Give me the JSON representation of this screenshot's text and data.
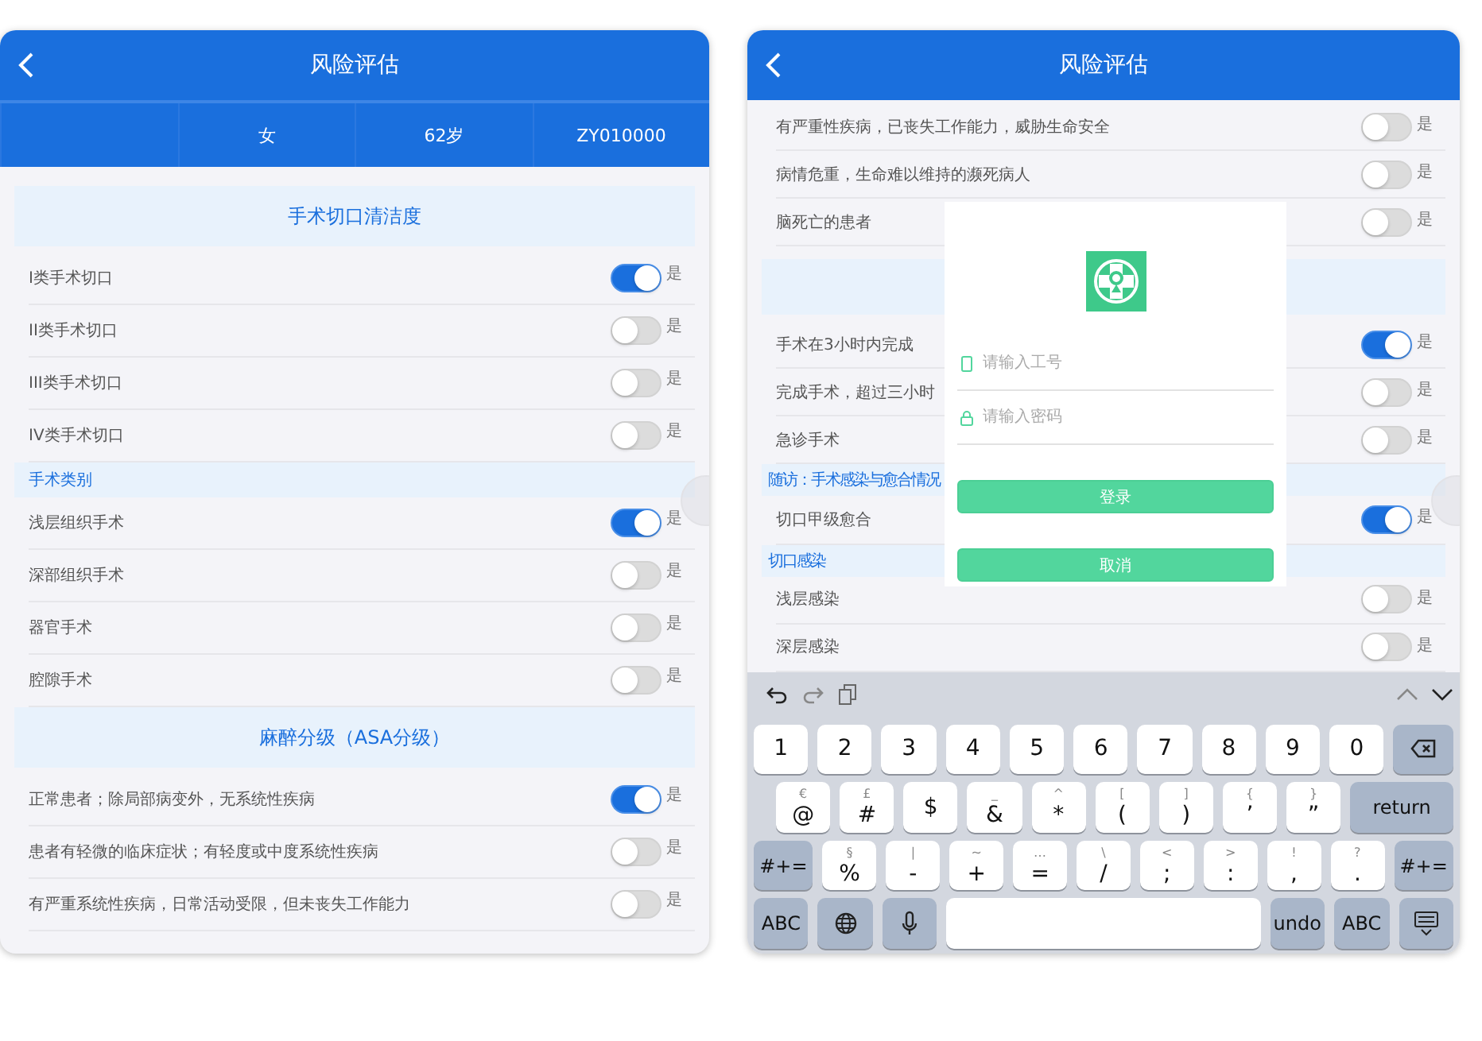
{
  "screens": [
    {
      "header": {
        "title": "风险评估"
      },
      "patient": [
        "女",
        "62岁",
        "ZY010000"
      ],
      "items": [
        {
          "kind": "section",
          "title": "手术切口清洁度"
        },
        {
          "kind": "toggle",
          "label": "I类手术切口",
          "on": true,
          "suffix": "是"
        },
        {
          "kind": "toggle",
          "label": "II类手术切口",
          "on": false,
          "suffix": "是"
        },
        {
          "kind": "toggle",
          "label": "III类手术切口",
          "on": false,
          "suffix": "是"
        },
        {
          "kind": "toggle",
          "label": "IV类手术切口",
          "on": false,
          "suffix": "是"
        },
        {
          "kind": "subsection",
          "title": "手术类别"
        },
        {
          "kind": "toggle",
          "label": "浅层组织手术",
          "on": true,
          "suffix": "是"
        },
        {
          "kind": "toggle",
          "label": "深部组织手术",
          "on": false,
          "suffix": "是"
        },
        {
          "kind": "toggle",
          "label": "器官手术",
          "on": false,
          "suffix": "是"
        },
        {
          "kind": "toggle",
          "label": "腔隙手术",
          "on": false,
          "suffix": "是"
        },
        {
          "kind": "section",
          "title": "麻醉分级（ASA分级）"
        },
        {
          "kind": "toggle",
          "label": "正常患者；除局部病变外，无系统性疾病",
          "on": true,
          "suffix": "是"
        },
        {
          "kind": "toggle",
          "label": "患者有轻微的临床症状；有轻度或中度系统性疾病",
          "on": false,
          "suffix": "是"
        },
        {
          "kind": "toggle",
          "label": "有严重系统性疾病，日常活动受限，但未丧失工作能力",
          "on": false,
          "suffix": "是"
        }
      ]
    },
    {
      "header": {
        "title": "风险评估"
      },
      "items": [
        {
          "kind": "toggle",
          "label": "有严重性疾病，已丧失工作能力，威胁生命安全",
          "on": false,
          "suffix": "是"
        },
        {
          "kind": "toggle",
          "label": "病情危重，生命难以维持的濒死病人",
          "on": false,
          "suffix": "是"
        },
        {
          "kind": "toggle",
          "label": "脑死亡的患者",
          "on": false,
          "suffix": "是"
        },
        {
          "kind": "section"
        },
        {
          "kind": "toggle",
          "label": "手术在3小时内完成",
          "on": true,
          "suffix": "是"
        },
        {
          "kind": "toggle",
          "label": "完成手术，超过三小时",
          "on": false,
          "suffix": "是"
        },
        {
          "kind": "toggle",
          "label": "急诊手术",
          "on": false,
          "suffix": "是"
        },
        {
          "kind": "subsection",
          "title": "随访：手术感染与愈合情况"
        },
        {
          "kind": "toggle",
          "label": "切口甲级愈合",
          "on": true,
          "suffix": "是"
        },
        {
          "kind": "subsection",
          "title": "切口感染"
        },
        {
          "kind": "toggle",
          "label": "浅层感染",
          "on": false,
          "suffix": "是"
        },
        {
          "kind": "toggle",
          "label": "深层感染",
          "on": false,
          "suffix": "是"
        }
      ],
      "dialog": {
        "fields": [
          {
            "kind": "phone",
            "placeholder": "请输入工号"
          },
          {
            "kind": "lock",
            "placeholder": "请输入密码"
          }
        ],
        "buttons": [
          "登录",
          "取消"
        ]
      },
      "keyboard": {
        "number_row": [
          {
            "kind": "key",
            "main": "1"
          },
          {
            "kind": "key",
            "main": "2"
          },
          {
            "kind": "key",
            "main": "3"
          },
          {
            "kind": "key",
            "main": "4"
          },
          {
            "kind": "key",
            "main": "5"
          },
          {
            "kind": "key",
            "main": "6"
          },
          {
            "kind": "key",
            "main": "7"
          },
          {
            "kind": "key",
            "main": "8"
          },
          {
            "kind": "key",
            "main": "9"
          },
          {
            "kind": "key",
            "main": "0"
          },
          {
            "kind": "delete"
          }
        ],
        "symbol_row": [
          {
            "kind": "key",
            "alt": "€",
            "main": "@"
          },
          {
            "kind": "key",
            "alt": "£",
            "main": "#"
          },
          {
            "kind": "key",
            "main": "$"
          },
          {
            "kind": "key",
            "alt": "_",
            "main": "&"
          },
          {
            "kind": "key",
            "alt": "^",
            "main": "*"
          },
          {
            "kind": "key",
            "alt": "[",
            "main": "("
          },
          {
            "kind": "key",
            "alt": "]",
            "main": ")"
          },
          {
            "kind": "key",
            "alt": "{",
            "main": "’"
          },
          {
            "kind": "key",
            "alt": "}",
            "main": "”"
          },
          {
            "kind": "action",
            "main": "return"
          }
        ],
        "punctuation_row": [
          {
            "kind": "action",
            "main": "#+="
          },
          {
            "kind": "key",
            "alt": "§",
            "main": "%"
          },
          {
            "kind": "key",
            "alt": "|",
            "main": "-"
          },
          {
            "kind": "key",
            "alt": "~",
            "main": "+"
          },
          {
            "kind": "key",
            "alt": "…",
            "main": "="
          },
          {
            "kind": "key",
            "alt": "\\",
            "main": "/"
          },
          {
            "kind": "key",
            "alt": "<",
            "main": ";"
          },
          {
            "kind": "key",
            "alt": ">",
            "main": ":"
          },
          {
            "kind": "key",
            "alt": "!",
            "main": ","
          },
          {
            "kind": "key",
            "alt": "?",
            "main": "."
          },
          {
            "kind": "action",
            "main": "#+="
          }
        ],
        "bottom_row": [
          {
            "kind": "action",
            "main": "ABC"
          },
          {
            "kind": "globe"
          },
          {
            "kind": "mic"
          },
          {
            "kind": "space"
          },
          {
            "kind": "action",
            "main": "undo"
          },
          {
            "kind": "action",
            "main": "ABC"
          },
          {
            "kind": "hide"
          }
        ]
      }
    }
  ]
}
